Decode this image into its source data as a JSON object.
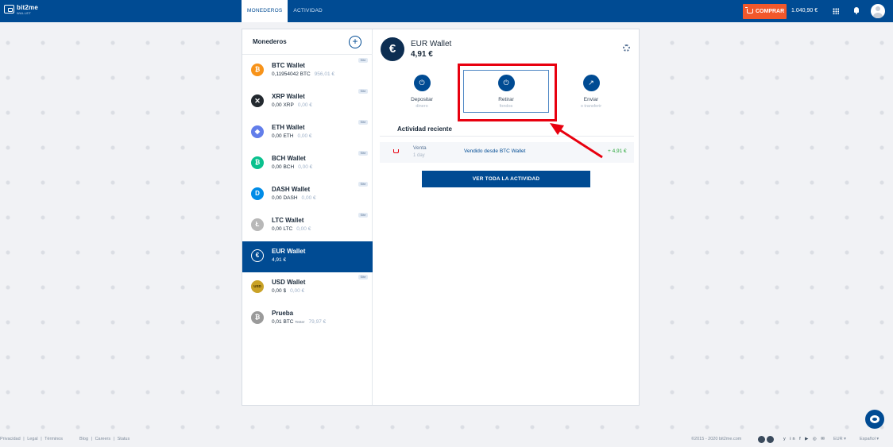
{
  "brand": {
    "name": "bit2me",
    "sub": "WALLET"
  },
  "header": {
    "tabs": [
      {
        "label": "MONEDEROS"
      },
      {
        "label": "ACTIVIDAD"
      }
    ],
    "buy_label": "COMPRAR",
    "balance": "1.040,90 €"
  },
  "sidebar": {
    "title": "Monederos",
    "add_symbol": "+",
    "wallets": [
      {
        "name": "BTC Wallet",
        "balance": "0,11954042 BTC",
        "fiat": "956,01 €",
        "badge": "Site",
        "symbol": "₿",
        "color": "#f7931a"
      },
      {
        "name": "XRP Wallet",
        "balance": "0,00 XRP",
        "fiat": "0,00 €",
        "badge": "Site",
        "symbol": "✕",
        "color": "#23292f"
      },
      {
        "name": "ETH Wallet",
        "balance": "0,00 ETH",
        "fiat": "0,00 €",
        "badge": "Site",
        "symbol": "◆",
        "color": "#627eea"
      },
      {
        "name": "BCH Wallet",
        "balance": "0,00 BCH",
        "fiat": "0,00 €",
        "badge": "Site",
        "symbol": "₿",
        "color": "#0ac18e"
      },
      {
        "name": "DASH Wallet",
        "balance": "0,00 DASH",
        "fiat": "0,00 €",
        "badge": "Site",
        "symbol": "D",
        "color": "#008ce7"
      },
      {
        "name": "LTC Wallet",
        "balance": "0,00 LTC",
        "fiat": "0,00 €",
        "badge": "Site",
        "symbol": "Ł",
        "color": "#b8b8b8"
      },
      {
        "name": "EUR Wallet",
        "balance": "4,91 €",
        "symbol": "€",
        "color": "#004b93"
      },
      {
        "name": "USD Wallet",
        "balance": "0,00 $",
        "fiat": "0,00 €",
        "badge": "Site",
        "symbol": "USD",
        "color": "#c9a227"
      },
      {
        "name": "Prueba",
        "balance": "0,01 BTC",
        "sub": "Tester",
        "fiat": "79,97 €",
        "symbol": "₿",
        "color": "#9a9a9a"
      }
    ]
  },
  "detail": {
    "title": "EUR Wallet",
    "amount": "4,91 €",
    "currency_symbol": "€",
    "actions": [
      {
        "label": "Depositar",
        "sub": "dinero",
        "symbol": "⏻"
      },
      {
        "label": "Retirar",
        "sub": "fondos",
        "symbol": "⏻"
      },
      {
        "label": "Enviar",
        "sub": "o transferir",
        "symbol": "↗"
      }
    ],
    "recent_title": "Actividad reciente",
    "activity": [
      {
        "type": "Venta",
        "time": "1 day",
        "desc": "Vendido desde BTC Wallet",
        "amount": "+ 4,91 €"
      }
    ],
    "view_all": "VER TODA LA ACTIVIDAD"
  },
  "footer": {
    "left": [
      "Privacidad",
      "|",
      "Legal",
      "|",
      "Términos",
      "Blog",
      "|",
      "Careers",
      "|",
      "Status"
    ],
    "copyright": "©2015 - 2020 bit2me.com",
    "currency": "EUR ▾",
    "language": "Español ▾"
  }
}
